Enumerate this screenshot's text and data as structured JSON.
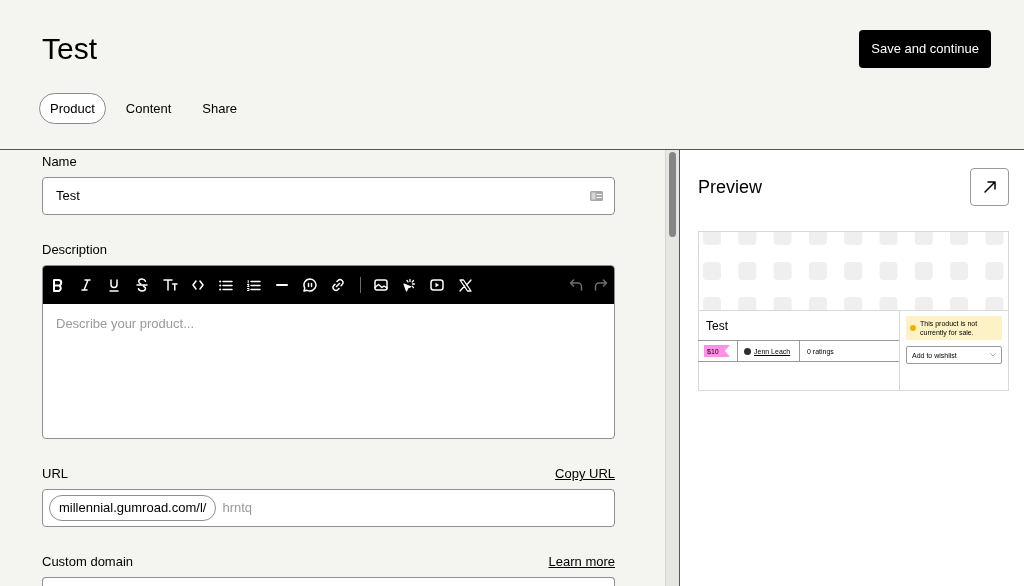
{
  "header": {
    "title": "Test",
    "save_button": "Save and continue"
  },
  "tabs": [
    {
      "label": "Product",
      "selected": true
    },
    {
      "label": "Content",
      "selected": false
    },
    {
      "label": "Share",
      "selected": false
    }
  ],
  "name_field": {
    "label": "Name",
    "value": "Test"
  },
  "description_field": {
    "label": "Description",
    "placeholder": "Describe your product...",
    "undo": {
      "disabled": true
    },
    "redo": {
      "disabled": true
    }
  },
  "url_field": {
    "label": "URL",
    "link": "Copy URL",
    "prefix": "millennial.gumroad.com/l/",
    "placeholder": "hrntq"
  },
  "custom_domain_field": {
    "label": "Custom domain",
    "link": "Learn more"
  },
  "preview": {
    "title": "Preview",
    "product": {
      "name": "Test",
      "price": "$10",
      "creator": "Jenn Leach",
      "ratings": "0 ratings",
      "notice": "This product is not currently for sale.",
      "wishlist_select": {
        "value": "Add to wishlist"
      }
    }
  }
}
